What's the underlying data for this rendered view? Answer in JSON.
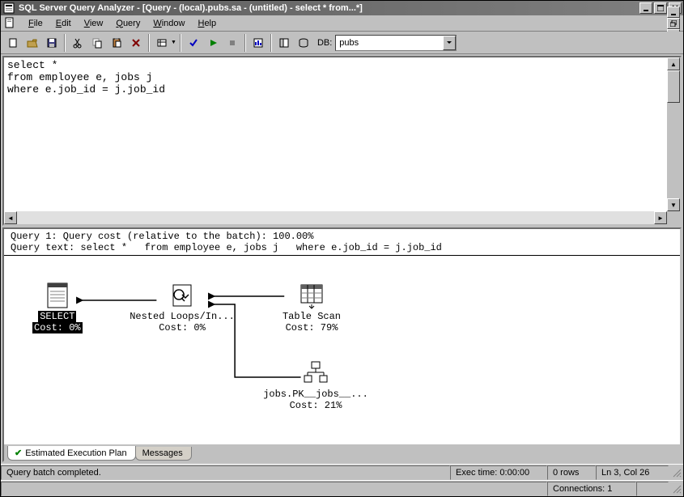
{
  "title": "SQL Server Query Analyzer - [Query - (local).pubs.sa - (untitled) - select *   from...*]",
  "menu": {
    "items": [
      {
        "label": "File",
        "accel": "F"
      },
      {
        "label": "Edit",
        "accel": "E"
      },
      {
        "label": "View",
        "accel": "V"
      },
      {
        "label": "Query",
        "accel": "Q"
      },
      {
        "label": "Window",
        "accel": "W"
      },
      {
        "label": "Help",
        "accel": "H"
      }
    ]
  },
  "toolbar": {
    "db_label": "DB:",
    "db_value": "pubs"
  },
  "sql": "select *\nfrom employee e, jobs j\nwhere e.job_id = j.job_id",
  "plan": {
    "header_line1": "Query 1: Query cost (relative to the batch): 100.00%",
    "header_line2": "Query text: select *   from employee e, jobs j   where e.job_id = j.job_id",
    "nodes": {
      "select": {
        "label": "SELECT",
        "cost": "Cost: 0%"
      },
      "nested": {
        "label": "Nested Loops/In...",
        "cost": "Cost: 0%"
      },
      "tablescan": {
        "label": "Table Scan",
        "cost": "Cost: 79%"
      },
      "indexseek": {
        "label": "jobs.PK__jobs__...",
        "cost": "Cost: 21%"
      }
    }
  },
  "tabs": {
    "plan": "Estimated Execution Plan",
    "messages": "Messages"
  },
  "status": {
    "msg": "Query batch completed.",
    "exec": "Exec time: 0:00:00",
    "rows": "0 rows",
    "pos": "Ln 3, Col 26",
    "connections": "Connections: 1"
  }
}
